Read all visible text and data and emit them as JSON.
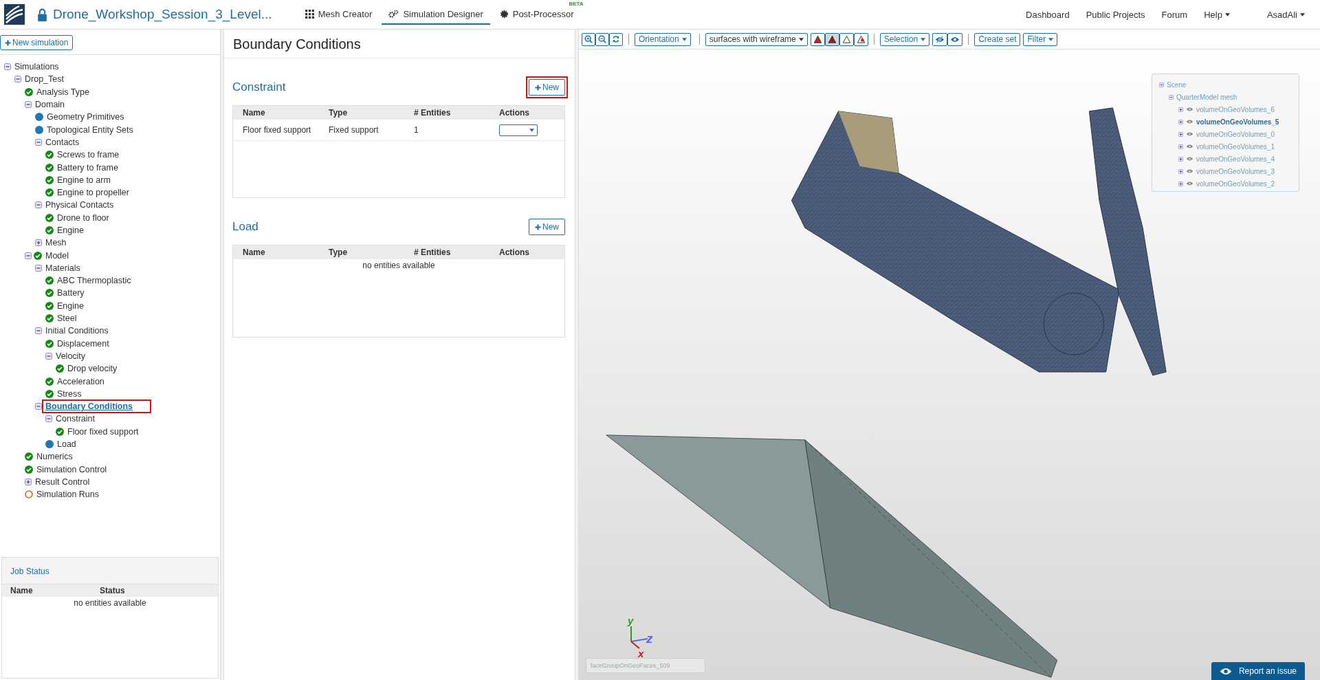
{
  "header": {
    "title": "Drone_Workshop_Session_3_Level...",
    "tabs": [
      {
        "label": "Mesh Creator",
        "selected": false
      },
      {
        "label": "Simulation Designer",
        "selected": true
      },
      {
        "label": "Post-Processor",
        "selected": false,
        "badge": "BETA"
      }
    ],
    "links": [
      "Dashboard",
      "Public Projects",
      "Forum"
    ],
    "menus": [
      "Help",
      "AsadAli"
    ]
  },
  "sidebar": {
    "new_button": "New simulation",
    "tree": [
      {
        "label": "Simulations",
        "expanded": true,
        "selected": false,
        "children": [
          {
            "label": "Drop_Test",
            "expanded": true,
            "selected": false,
            "children": [
              {
                "label": "Analysis Type",
                "kind": "check",
                "selected": false
              },
              {
                "label": "Domain",
                "expanded": true,
                "selected": false,
                "children": [
                  {
                    "label": "Geometry Primitives",
                    "kind": "dot",
                    "selected": false
                  },
                  {
                    "label": "Topological Entity Sets",
                    "kind": "dot",
                    "selected": false
                  },
                  {
                    "label": "Contacts",
                    "expanded": true,
                    "selected": false,
                    "children": [
                      {
                        "label": "Screws to frame",
                        "kind": "check",
                        "selected": false
                      },
                      {
                        "label": "Battery to frame",
                        "kind": "check",
                        "selected": false
                      },
                      {
                        "label": "Engine to arm",
                        "kind": "check",
                        "selected": false
                      },
                      {
                        "label": "Engine to propeller",
                        "kind": "check",
                        "selected": false
                      }
                    ]
                  },
                  {
                    "label": "Physical Contacts",
                    "expanded": true,
                    "selected": false,
                    "children": [
                      {
                        "label": "Drone to floor",
                        "kind": "check",
                        "selected": false
                      },
                      {
                        "label": "Engine",
                        "kind": "check",
                        "selected": false
                      }
                    ]
                  },
                  {
                    "label": "Mesh",
                    "expanded": false,
                    "selected": false
                  }
                ]
              },
              {
                "label": "Model",
                "kind": "check",
                "expanded": true,
                "selected": false,
                "children": [
                  {
                    "label": "Materials",
                    "expanded": true,
                    "selected": false,
                    "children": [
                      {
                        "label": "ABC Thermoplastic",
                        "kind": "check",
                        "selected": false
                      },
                      {
                        "label": "Battery",
                        "kind": "check",
                        "selected": false
                      },
                      {
                        "label": "Engine",
                        "kind": "check",
                        "selected": false
                      },
                      {
                        "label": "Steel",
                        "kind": "check",
                        "selected": false
                      }
                    ]
                  },
                  {
                    "label": "Initial Conditions",
                    "expanded": true,
                    "selected": false,
                    "children": [
                      {
                        "label": "Displacement",
                        "kind": "check",
                        "selected": false
                      },
                      {
                        "label": "Velocity",
                        "expanded": true,
                        "selected": false,
                        "children": [
                          {
                            "label": "Drop velocity",
                            "kind": "check",
                            "selected": false
                          }
                        ]
                      },
                      {
                        "label": "Acceleration",
                        "kind": "check",
                        "selected": false
                      },
                      {
                        "label": "Stress",
                        "kind": "check",
                        "selected": false
                      }
                    ]
                  },
                  {
                    "label": "Boundary Conditions",
                    "expanded": true,
                    "selected": true,
                    "children": [
                      {
                        "label": "Constraint",
                        "expanded": true,
                        "selected": false,
                        "children": [
                          {
                            "label": "Floor fixed support",
                            "kind": "check",
                            "selected": false
                          }
                        ]
                      },
                      {
                        "label": "Load",
                        "kind": "dot",
                        "selected": false
                      }
                    ]
                  }
                ]
              },
              {
                "label": "Numerics",
                "kind": "check",
                "selected": false
              },
              {
                "label": "Simulation Control",
                "kind": "check",
                "selected": false
              },
              {
                "label": "Result Control",
                "expanded": false,
                "selected": false
              },
              {
                "label": "Simulation Runs",
                "kind": "ring",
                "selected": false
              }
            ]
          }
        ]
      }
    ],
    "job_status": {
      "title": "Job Status",
      "columns": [
        "Name",
        "Status"
      ],
      "empty_message": "no entities available"
    }
  },
  "panel": {
    "title": "Boundary Conditions",
    "sections": [
      {
        "title": "Constraint",
        "button": "New",
        "highlighted": true,
        "columns": [
          "Name",
          "Type",
          "# Entities",
          "Actions"
        ],
        "rows": [
          {
            "cells": [
              "Floor fixed support",
              "Fixed support",
              "1"
            ]
          }
        ]
      },
      {
        "title": "Load",
        "button": "New",
        "highlighted": false,
        "columns": [
          "Name",
          "Type",
          "# Entities",
          "Actions"
        ],
        "empty_message": "no entities available"
      }
    ]
  },
  "viewer": {
    "toolbar": [
      [
        {
          "kind": "icon"
        },
        {
          "kind": "icon"
        },
        {
          "kind": "icon"
        }
      ],
      [
        {
          "kind": "dropdown",
          "label": "Orientation"
        }
      ],
      [
        {
          "kind": "select",
          "label": "surfaces with wireframe"
        },
        {
          "kind": "icon",
          "selected": false
        },
        {
          "kind": "icon",
          "selected": true
        },
        {
          "kind": "icon",
          "selected": false
        },
        {
          "kind": "icon",
          "selected": false
        }
      ],
      [
        {
          "kind": "dropdown",
          "label": "Selection"
        },
        {
          "kind": "icon"
        },
        {
          "kind": "icon"
        }
      ],
      [
        {
          "kind": "button",
          "label": "Create set"
        },
        {
          "kind": "dropdown",
          "label": "Filter"
        }
      ]
    ],
    "scene": {
      "label": "Scene",
      "expanded": true,
      "children": [
        {
          "label": "QuarterModel mesh",
          "expanded": true,
          "children": [
            {
              "label": "volumeOnGeoVolumes_6",
              "selected": false
            },
            {
              "label": "volumeOnGeoVolumes_5",
              "selected": true
            },
            {
              "label": "volumeOnGeoVolumes_0",
              "selected": false
            },
            {
              "label": "volumeOnGeoVolumes_1",
              "selected": false
            },
            {
              "label": "volumeOnGeoVolumes_4",
              "selected": false
            },
            {
              "label": "volumeOnGeoVolumes_3",
              "selected": false
            },
            {
              "label": "volumeOnGeoVolumes_2",
              "selected": false
            }
          ]
        }
      ]
    },
    "axes": [
      "x",
      "y",
      "z"
    ],
    "face_label": "faceGroupOnGeoFaces_509",
    "report_button": "Report an issue"
  }
}
